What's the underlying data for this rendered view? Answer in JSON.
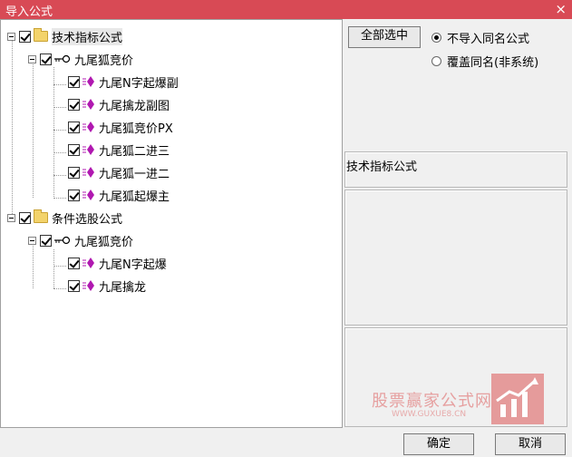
{
  "window": {
    "title": "导入公式",
    "close_icon": "×"
  },
  "tree": {
    "groups": [
      {
        "label": "技术指标公式",
        "checked": true,
        "subgroups": [
          {
            "label": "九尾狐竞价",
            "checked": true,
            "items": [
              "九尾N字起爆副",
              "九尾擒龙副图",
              "九尾狐竞价PX",
              "九尾狐二进三",
              "九尾狐一进二",
              "九尾狐起爆主"
            ]
          }
        ]
      },
      {
        "label": "条件选股公式",
        "checked": true,
        "subgroups": [
          {
            "label": "九尾狐竞价",
            "checked": true,
            "items": [
              "九尾N字起爆",
              "九尾擒龙"
            ]
          }
        ]
      }
    ]
  },
  "options": {
    "select_all_label": "全部选中",
    "radio_no_import": "不导入同名公式",
    "radio_overwrite": "覆盖同名(非系统)",
    "selected": "no_import"
  },
  "info": {
    "text": "技术指标公式"
  },
  "watermark": {
    "title": "股票赢家公式网",
    "url": "WWW.GUXUE8.CN"
  },
  "footer": {
    "ok_label": "确定",
    "cancel_label": "取消"
  },
  "colors": {
    "titlebar": "#d84a55",
    "gem": "#b018b0"
  }
}
